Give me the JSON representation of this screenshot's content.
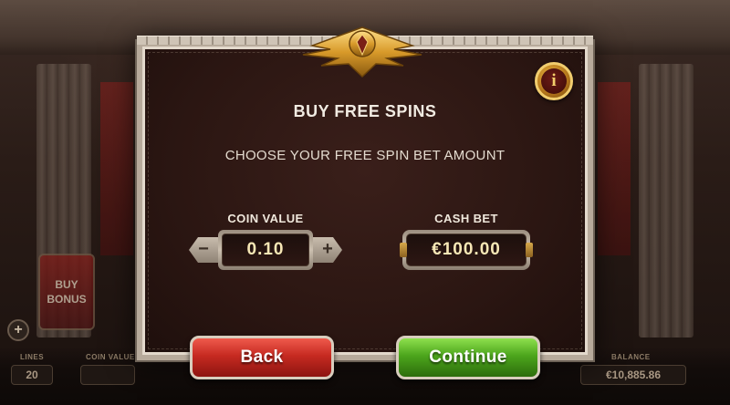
{
  "background": {
    "buy_bonus_label_line1": "BUY",
    "buy_bonus_label_line2": "BONUS",
    "hud": {
      "lines_label": "LINES",
      "lines_value": "20",
      "coin_value_label": "COIN VALUE",
      "balance_label": "BALANCE",
      "balance_value": "€10,885.86"
    }
  },
  "modal": {
    "title": "BUY FREE SPINS",
    "subtitle": "CHOOSE YOUR FREE SPIN BET AMOUNT",
    "info_icon_glyph": "i",
    "coin_value": {
      "label": "COIN VALUE",
      "value": "0.10",
      "minus_glyph": "−",
      "plus_glyph": "+"
    },
    "cash_bet": {
      "label": "CASH BET",
      "value": "€100.00"
    },
    "back_label": "Back",
    "continue_label": "Continue"
  },
  "colors": {
    "panel": "#2b1612",
    "frame": "#b7aa9b",
    "back_button": "#c62a21",
    "continue_button": "#4ca51c",
    "gold": "#e9b43e"
  },
  "icons": [
    "eagle-emblem-icon",
    "info-icon",
    "minus-icon",
    "plus-icon"
  ]
}
